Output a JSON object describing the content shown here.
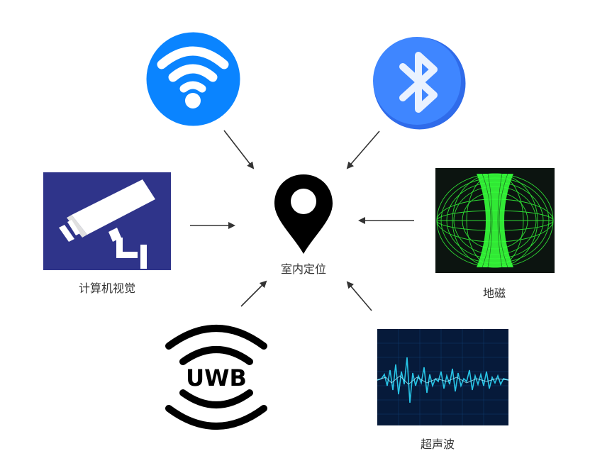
{
  "center": {
    "label": "室内定位"
  },
  "nodes": {
    "vision": {
      "label": "计算机视觉",
      "icon": "surveillance-camera-icon"
    },
    "geomagnetic": {
      "label": "地磁",
      "icon": "magnetic-field-icon"
    },
    "uwb": {
      "label": "UWB",
      "icon": "uwb-icon"
    },
    "ultrasonic": {
      "label": "超声波",
      "icon": "sound-wave-icon"
    },
    "wifi": {
      "icon": "wifi-icon"
    },
    "bluetooth": {
      "icon": "bluetooth-icon"
    }
  },
  "colors": {
    "wifi_blue": "#0a84ff",
    "bluetooth_blue": "#3b7bff",
    "camera_bg": "#2f348a",
    "field_green": "#35ff3a",
    "wave_cyan": "#27c4e6"
  }
}
